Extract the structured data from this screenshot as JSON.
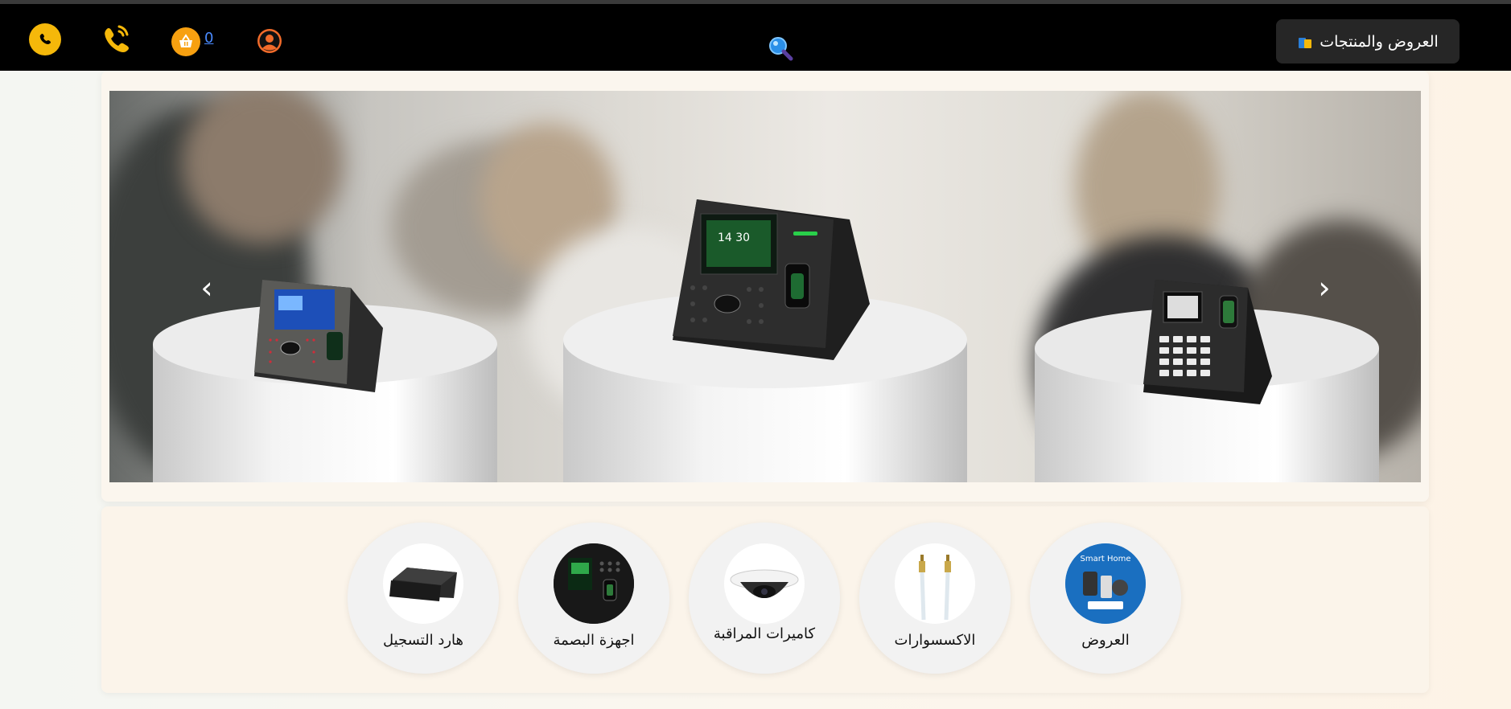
{
  "navbar": {
    "offers_button_label": "العروض والمنتجات",
    "cart_count": "0",
    "icons": [
      "whatsapp-icon",
      "phone-icon",
      "cart-icon",
      "user-icon",
      "search-icon",
      "bag-icon"
    ]
  },
  "slider": {
    "prev_arrow": "‹",
    "next_arrow": "›",
    "devices": [
      "left device",
      "center device",
      "right device"
    ],
    "device_screen_time": "14 30"
  },
  "categories": [
    {
      "label": "العروض",
      "icon": "smart-home-icon"
    },
    {
      "label": "الاكسسوارات",
      "icon": "cable-icon"
    },
    {
      "label": "كاميرات المراقبة",
      "icon": "dome-camera-icon"
    },
    {
      "label": "اجهزة البصمة",
      "icon": "fingerprint-device-icon"
    },
    {
      "label": "هارد التسجيل",
      "icon": "dvr-icon"
    }
  ],
  "colors": {
    "navbar_bg": "#000000",
    "accent_yellow": "#f5b80a",
    "cart_orange": "#f7a010",
    "link_blue": "#4a8bff"
  }
}
